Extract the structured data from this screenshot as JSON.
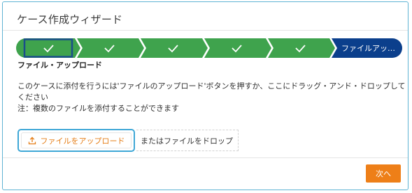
{
  "dialog": {
    "title": "ケース作成ウィザード"
  },
  "stepper": {
    "steps": [
      {
        "state": "completed",
        "icon": "check-icon"
      },
      {
        "state": "completed",
        "icon": "check-icon"
      },
      {
        "state": "completed",
        "icon": "check-icon"
      },
      {
        "state": "completed",
        "icon": "check-icon"
      },
      {
        "state": "completed",
        "icon": "check-icon"
      },
      {
        "state": "current",
        "label": "ファイルアッ…"
      }
    ],
    "current_step_label": "ファイル・アップロード",
    "colors": {
      "completed": "#3fa34d",
      "current": "#0b3f8c",
      "selected_outline": "#1a4e8a"
    }
  },
  "content": {
    "description_line1": "このケースに添付を行うには'ファイルのアップロード'ボタンを押すか、ここにドラッグ・アンド・ドロップして",
    "description_line2": "ください",
    "note": "注：複数のファイルを添付することができます"
  },
  "upload": {
    "button_label": "ファイルをアップロード",
    "icon": "upload-icon",
    "drop_text": "またはファイルをドロップ",
    "accent_color": "#e57d16"
  },
  "footer": {
    "next_label": "次へ",
    "next_color": "#ee7f18"
  }
}
